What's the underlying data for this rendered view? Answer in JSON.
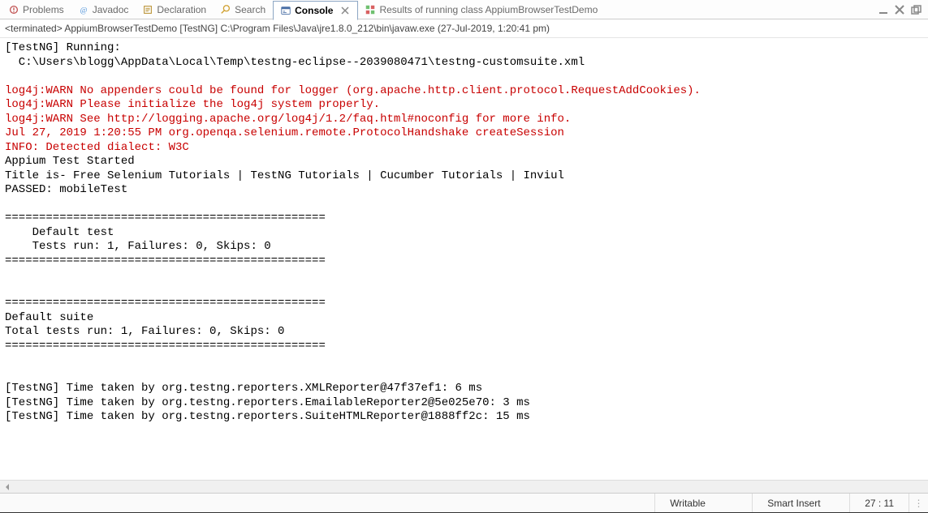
{
  "tabs": {
    "problems": "Problems",
    "javadoc": "Javadoc",
    "declaration": "Declaration",
    "search": "Search",
    "console": "Console",
    "results": "Results of running class AppiumBrowserTestDemo"
  },
  "header": "<terminated> AppiumBrowserTestDemo [TestNG] C:\\Program Files\\Java\\jre1.8.0_212\\bin\\javaw.exe (27-Jul-2019, 1:20:41 pm)",
  "console": {
    "l1": "[TestNG] Running:",
    "l2": "  C:\\Users\\blogg\\AppData\\Local\\Temp\\testng-eclipse--2039080471\\testng-customsuite.xml",
    "l3": "",
    "r1": "log4j:WARN No appenders could be found for logger (org.apache.http.client.protocol.RequestAddCookies).",
    "r2": "log4j:WARN Please initialize the log4j system properly.",
    "r3": "log4j:WARN See http://logging.apache.org/log4j/1.2/faq.html#noconfig for more info.",
    "r4": "Jul 27, 2019 1:20:55 PM org.openqa.selenium.remote.ProtocolHandshake createSession",
    "r5": "INFO: Detected dialect: W3C",
    "l4": "Appium Test Started",
    "l5": "Title is- Free Selenium Tutorials | TestNG Tutorials | Cucumber Tutorials | Inviul",
    "l6": "PASSED: mobileTest",
    "l7": "",
    "l8": "===============================================",
    "l9": "    Default test",
    "l10": "    Tests run: 1, Failures: 0, Skips: 0",
    "l11": "===============================================",
    "l12": "",
    "l13": "",
    "l14": "===============================================",
    "l15": "Default suite",
    "l16": "Total tests run: 1, Failures: 0, Skips: 0",
    "l17": "===============================================",
    "l18": "",
    "l19": "",
    "l20": "[TestNG] Time taken by org.testng.reporters.XMLReporter@47f37ef1: 6 ms",
    "l21": "[TestNG] Time taken by org.testng.reporters.EmailableReporter2@5e025e70: 3 ms",
    "l22": "[TestNG] Time taken by org.testng.reporters.SuiteHTMLReporter@1888ff2c: 15 ms"
  },
  "status": {
    "writable": "Writable",
    "insert": "Smart Insert",
    "pos": "27 : 11"
  }
}
